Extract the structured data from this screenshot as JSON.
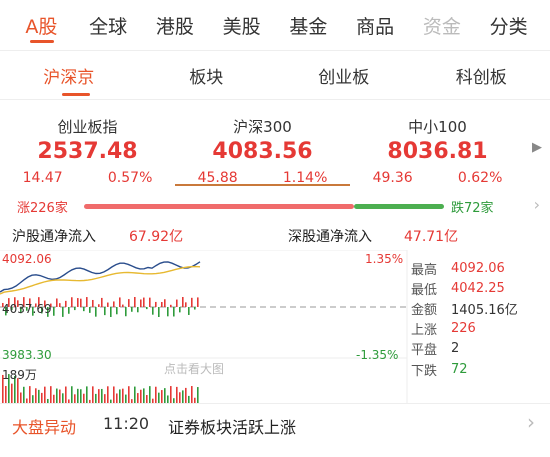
{
  "top_tabs": [
    {
      "label": "A股",
      "active": true
    },
    {
      "label": "全球"
    },
    {
      "label": "港股"
    },
    {
      "label": "美股"
    },
    {
      "label": "基金"
    },
    {
      "label": "商品"
    },
    {
      "label": "资金"
    },
    {
      "label": "分类"
    }
  ],
  "sub_tabs": [
    {
      "label": "沪深京",
      "active": true
    },
    {
      "label": "板块"
    },
    {
      "label": "创业板"
    },
    {
      "label": "科创板"
    }
  ],
  "indices": [
    {
      "name": "创业板指",
      "value": "2537.48",
      "change": "14.47",
      "pct": "0.57%"
    },
    {
      "name": "沪深300",
      "value": "4083.56",
      "change": "45.88",
      "pct": "1.14%"
    },
    {
      "name": "中小100",
      "value": "8036.81",
      "change": "49.36",
      "pct": "0.62%"
    }
  ],
  "breadth": {
    "up_label": "涨226家",
    "down_label": "跌72家",
    "up": 226,
    "down": 72
  },
  "flow": {
    "sh_label": "沪股通净流入",
    "sh_amount": "67.92亿",
    "sz_label": "深股通净流入",
    "sz_amount": "47.71亿"
  },
  "chart": {
    "high_label": "4092.06",
    "mid_label": "4037.69",
    "low_label": "3983.30",
    "high_pct": "1.35%",
    "low_pct": "-1.35%",
    "vol_label": "189万",
    "watermark": "点击看大图"
  },
  "stats": [
    {
      "key": "最高",
      "value": "4092.06",
      "tone": "red"
    },
    {
      "key": "最低",
      "value": "4042.25",
      "tone": "red"
    },
    {
      "key": "金额",
      "value": "1405.16亿",
      "tone": "neutral"
    },
    {
      "key": "上涨",
      "value": "226",
      "tone": "red"
    },
    {
      "key": "平盘",
      "value": "2",
      "tone": "neutral"
    },
    {
      "key": "下跌",
      "value": "72",
      "tone": "green"
    }
  ],
  "news": {
    "label": "大盘异动",
    "time": "11:20",
    "text": "证券板块活跃上涨"
  },
  "colors": {
    "accent": "#e8542a",
    "up": "#e53935",
    "down": "#2e9b3b",
    "line_main": "#2a4d8c",
    "line_avg": "#e7b931"
  }
}
